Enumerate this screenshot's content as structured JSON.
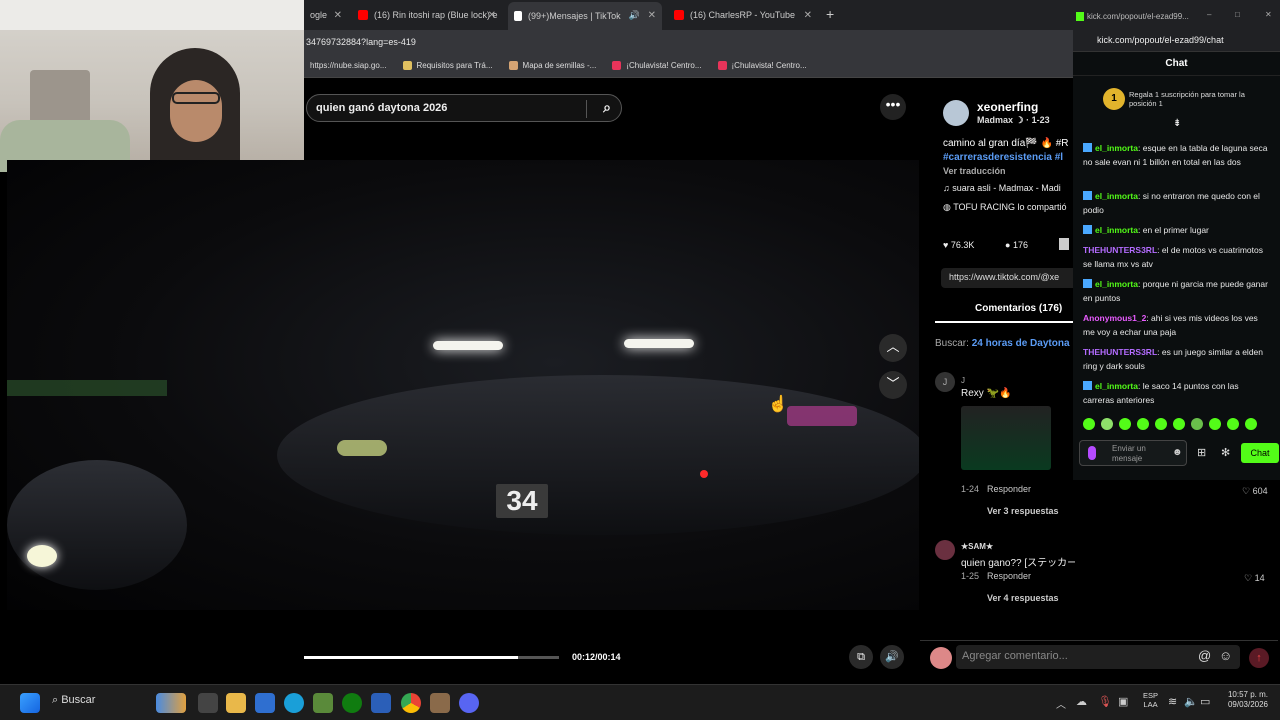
{
  "browser": {
    "tabs": [
      {
        "label": "ogle",
        "icon_color": "#888888"
      },
      {
        "label": "(16) Rin itoshi rap (Blue lock) e",
        "icon_color": "#ff0000"
      },
      {
        "label": "(99+)Mensajes | TikTok",
        "icon_color": "#ffffff",
        "active": true
      },
      {
        "label": "(16) CharlesRP - YouTube",
        "icon_color": "#ff0000"
      }
    ],
    "new_tab": "+",
    "url": "34769732884?lang=es-419",
    "bookmarks": [
      {
        "label": "https://nube.siap.go...",
        "icon_color": "#888888"
      },
      {
        "label": "Requisitos para Trá...",
        "icon_color": "#e0c060"
      },
      {
        "label": "Mapa de semillas -...",
        "icon_color": "#d4a373"
      },
      {
        "label": "¡Chulavista! Centro...",
        "icon_color": "#e8345a"
      },
      {
        "label": "¡Chulavista! Centro...",
        "icon_color": "#e8345a"
      }
    ]
  },
  "tiktok": {
    "search_value": "quien ganó daytona 2026",
    "more_label": "•••",
    "video": {
      "car_number": "34",
      "time": "00:12/00:14",
      "progress": 0.84
    },
    "post": {
      "username": "xeonerfing",
      "sub": "Madmax ☽ · 1-23",
      "caption_1": "camino al gran día🏁 🔥 #R",
      "caption_2": "#carrerasderesistencia #l",
      "translate": "Ver traducción",
      "music": "♫  suara asli - Madmax - Madi",
      "collab": "TOFU RACING lo compartió",
      "likes": "76.3K",
      "comments": "176",
      "link": "https://www.tiktok.com/@xe"
    },
    "comments_tab": "Comentarios (176)",
    "search_hint_label": "Buscar:",
    "search_hint_value": "24 horas de Daytona",
    "comment_list": [
      {
        "initial": "J",
        "user": "J",
        "text": "Rexy 🦖🔥",
        "date": "1-24",
        "reply": "Responder",
        "likes": "604",
        "more": "Ver 3 respuestas"
      },
      {
        "initial": "",
        "user": "★SAM★",
        "text": "quien gano?? [ステッカー]",
        "date": "1-25",
        "reply": "Responder",
        "likes": "14",
        "more": "Ver 4 respuestas"
      }
    ],
    "add_comment": "Agregar comentario..."
  },
  "kick": {
    "window_title": "kick.com/popout/el-ezad99...",
    "url": "kick.com/popout/el-ezad99/chat",
    "header": "Chat",
    "sub_promo": "Regala 1 suscripción para tomar la posición 1",
    "messages": [
      {
        "user": "el_inmorta",
        "kind": "u",
        "badge": true,
        "text": "esque en la tabla de laguna seca no sale evan ni 1 billón en total en las dos"
      },
      {
        "user": "el_inmorta",
        "kind": "u",
        "badge": true,
        "text": "si no entraron me quedo con el podio"
      },
      {
        "user": "el_inmorta",
        "kind": "u",
        "badge": true,
        "text": "en el primer lugar"
      },
      {
        "user": "THEHUNTERS3RL",
        "kind": "p",
        "badge": false,
        "text": "el de motos vs cuatrimotos se llama mx vs atv"
      },
      {
        "user": "el_inmorta",
        "kind": "u",
        "badge": true,
        "text": "porque ni garcia me puede ganar en puntos"
      },
      {
        "user": "Anonymous1_2",
        "kind": "k",
        "badge": false,
        "text": "ahi si ves mis videos los ves me voy a echar una paja"
      },
      {
        "user": "THEHUNTERS3RL",
        "kind": "p",
        "badge": false,
        "text": "es un juego similar a elden ring y dark souls"
      },
      {
        "user": "el_inmorta",
        "kind": "u",
        "badge": true,
        "text": "le saco 14 puntos con las carreras anteriores"
      }
    ],
    "send_placeholder": "Enviar un mensaje",
    "chat_button": "Chat"
  },
  "taskbar": {
    "search": "Buscar",
    "lang_1": "ESP",
    "lang_2": "LAA",
    "time": "10:57 p. m.",
    "date": "09/03/2026"
  }
}
